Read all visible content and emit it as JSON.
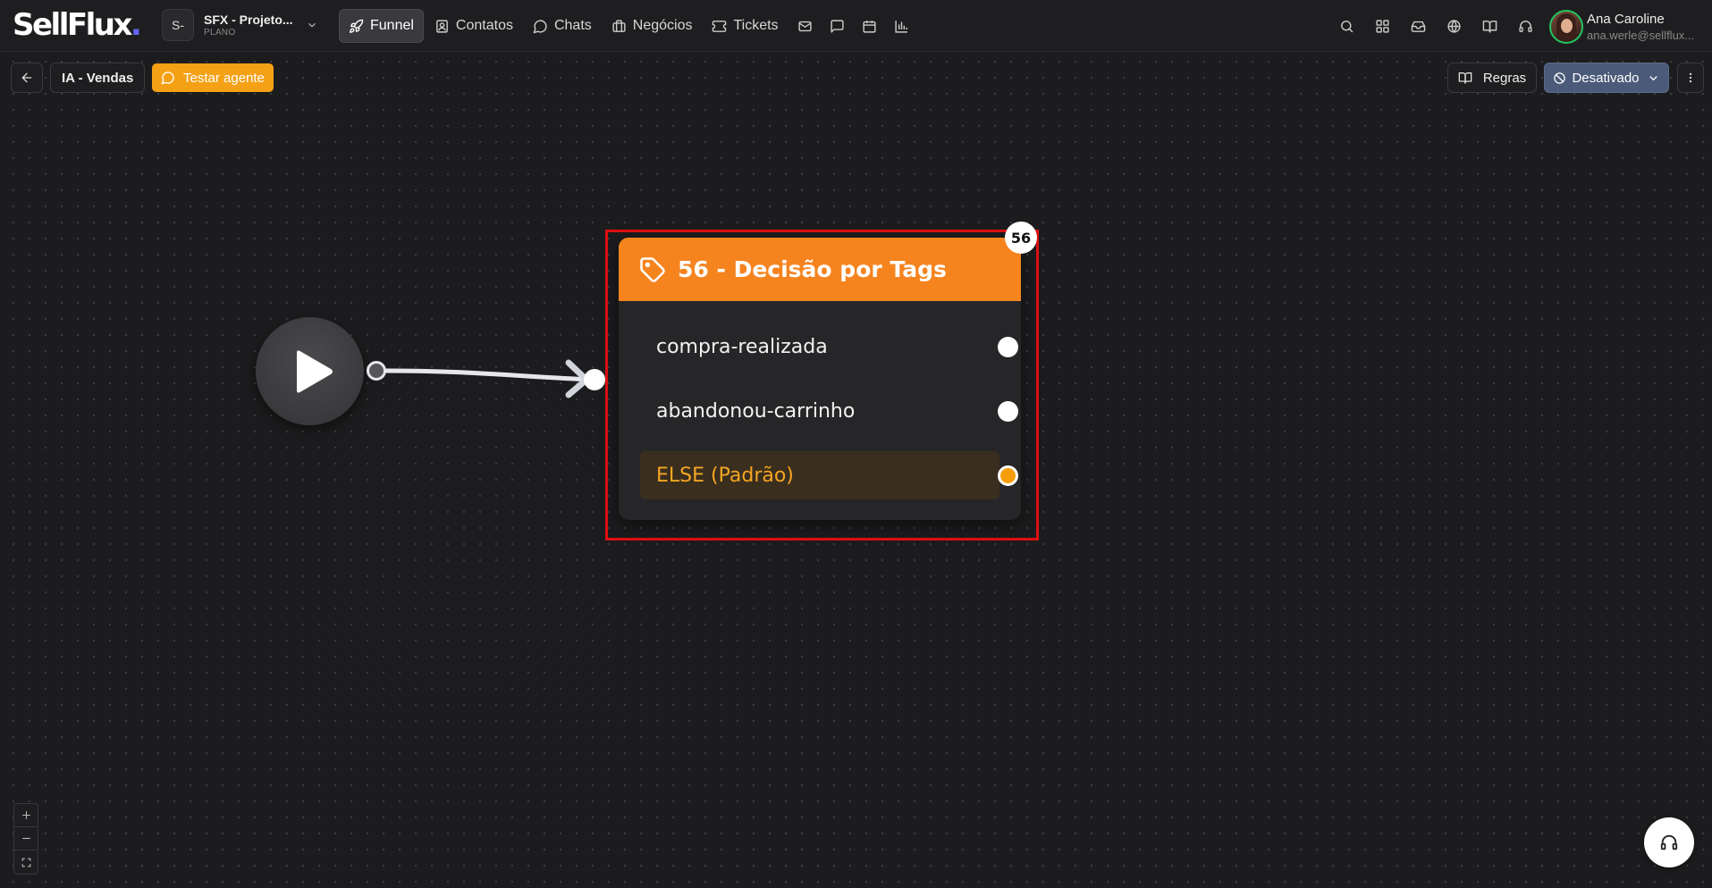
{
  "app": {
    "logo_text": "SellFlux",
    "logo_dot": ".",
    "project": {
      "badge": "S-",
      "name": "SFX - Projeto...",
      "plan_label": "PLANO"
    },
    "user": {
      "name": "Ana Caroline",
      "email": "ana.werle@sellflux..."
    }
  },
  "nav": {
    "funnel": "Funnel",
    "contacts": "Contatos",
    "chats": "Chats",
    "deals": "Negócios",
    "tickets": "Tickets"
  },
  "toolbar": {
    "agent_name": "IA - Vendas",
    "test_agent": "Testar agente",
    "rules": "Regras",
    "status": "Desativado"
  },
  "flow": {
    "node": {
      "id_badge": "56",
      "title": "56 - Decisão por Tags",
      "options": [
        "compra-realizada",
        "abandonou-carrinho"
      ],
      "else_label": "ELSE (Padrão)"
    }
  },
  "colors": {
    "accent_orange": "#f5841f",
    "test_button": "#f5a116",
    "status_button": "#4a5a78",
    "highlight_box": "#e01010",
    "else_text": "#f5a623"
  },
  "icons": [
    "rocket-icon",
    "contacts-icon",
    "chat-icon",
    "briefcase-icon",
    "ticket-icon",
    "mail-icon",
    "message-square-icon",
    "calendar-icon",
    "chart-icon",
    "search-icon",
    "grid-icon",
    "inbox-icon",
    "globe-icon",
    "book-icon",
    "headset-icon",
    "arrow-left-icon",
    "tag-icon",
    "play-icon",
    "ban-icon",
    "more-vertical-icon"
  ]
}
